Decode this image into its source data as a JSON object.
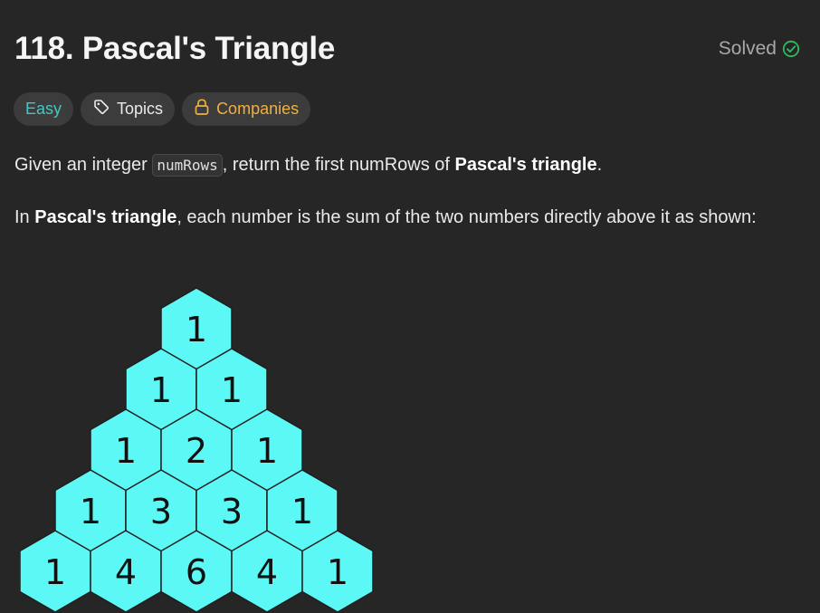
{
  "problem": {
    "title": "118. Pascal's Triangle",
    "status": "Solved"
  },
  "tags": {
    "difficulty": "Easy",
    "topics": "Topics",
    "companies": "Companies"
  },
  "description": {
    "p1_pre": "Given an integer ",
    "p1_code": "numRows",
    "p1_mid": ", return the first numRows of ",
    "p1_bold": "Pascal's triangle",
    "p1_end": ".",
    "p2_pre": "In ",
    "p2_bold": "Pascal's triangle",
    "p2_rest": ", each number is the sum of the two numbers directly above it as shown:"
  },
  "pascal_rows": [
    [
      "1"
    ],
    [
      "1",
      "1"
    ],
    [
      "1",
      "2",
      "1"
    ],
    [
      "1",
      "3",
      "3",
      "1"
    ],
    [
      "1",
      "4",
      "6",
      "4",
      "1"
    ]
  ],
  "colors": {
    "hex_fill": "#5cf8f6",
    "hex_stroke": "#1e1e1e",
    "easy": "#46c6c2",
    "companies": "#f0b040",
    "solved_check": "#2cbb5d"
  },
  "icons": {
    "solved": "check-circle-icon",
    "topics": "tag-icon",
    "companies": "lock-icon"
  }
}
